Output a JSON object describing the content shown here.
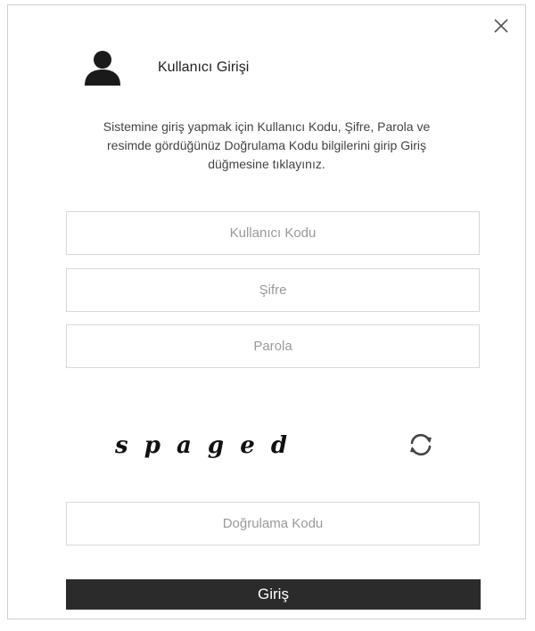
{
  "dialog": {
    "close_icon": "close-icon",
    "user_icon": "user-icon",
    "title": "Kullanıcı Girişi",
    "description": "Sistemine giriş yapmak için Kullanıcı Kodu, Şifre, Parola ve resimde gördüğünüz Doğrulama Kodu bilgilerini girip Giriş düğmesine tıklayınız."
  },
  "form": {
    "user_code": {
      "value": "",
      "placeholder": "Kullanıcı Kodu"
    },
    "password": {
      "value": "",
      "placeholder": "Şifre"
    },
    "passphrase": {
      "value": "",
      "placeholder": "Parola"
    },
    "captcha": {
      "text": "spaged",
      "refresh_icon": "refresh-icon"
    },
    "verification_code": {
      "value": "",
      "placeholder": "Doğrulama Kodu"
    },
    "submit_label": "Giriş"
  },
  "colors": {
    "button_bg": "#2b2b2b",
    "button_text": "#ffffff",
    "border": "#d9d9d9",
    "placeholder": "#9a9a9a"
  }
}
